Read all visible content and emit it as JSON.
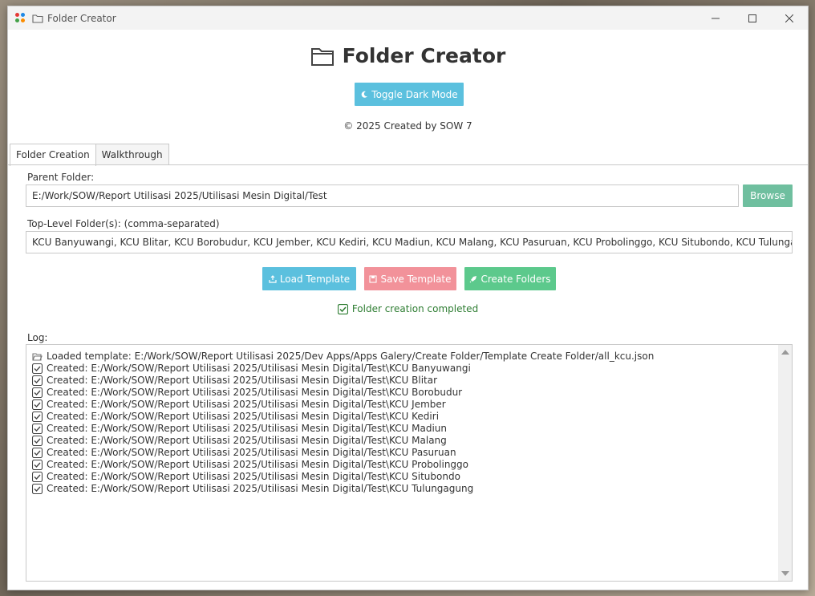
{
  "window": {
    "title": "Folder Creator",
    "controls": [
      "minimize-icon",
      "maximize-icon",
      "close-icon"
    ]
  },
  "header": {
    "title": "Folder Creator",
    "toggle_dark_label": "Toggle Dark Mode",
    "copyright": "© 2025 Created by SOW 7"
  },
  "tabs": [
    {
      "label": "Folder Creation",
      "active": true
    },
    {
      "label": "Walkthrough",
      "active": false
    }
  ],
  "form": {
    "parent_label": "Parent Folder:",
    "parent_value": "E:/Work/SOW/Report Utilisasi 2025/Utilisasi Mesin Digital/Test",
    "browse_label": "Browse",
    "top_label": "Top-Level Folder(s): (comma-separated)",
    "top_value": "KCU Banyuwangi, KCU Blitar, KCU Borobudur, KCU Jember, KCU Kediri, KCU Madiun, KCU Malang, KCU Pasuruan, KCU Probolinggo, KCU Situbondo, KCU Tulungagung"
  },
  "actions": {
    "load_label": "Load Template",
    "save_label": "Save Template",
    "create_label": "Create Folders"
  },
  "status": {
    "text": "Folder creation completed"
  },
  "log": {
    "label": "Log:",
    "lines": [
      {
        "icon": "folder-open-icon",
        "text": "Loaded template: E:/Work/SOW/Report Utilisasi 2025/Dev Apps/Apps Galery/Create Folder/Template Create Folder/all_kcu.json"
      },
      {
        "icon": "check-icon",
        "text": "Created: E:/Work/SOW/Report Utilisasi 2025/Utilisasi Mesin Digital/Test\\KCU Banyuwangi"
      },
      {
        "icon": "check-icon",
        "text": "Created: E:/Work/SOW/Report Utilisasi 2025/Utilisasi Mesin Digital/Test\\KCU Blitar"
      },
      {
        "icon": "check-icon",
        "text": "Created: E:/Work/SOW/Report Utilisasi 2025/Utilisasi Mesin Digital/Test\\KCU Borobudur"
      },
      {
        "icon": "check-icon",
        "text": "Created: E:/Work/SOW/Report Utilisasi 2025/Utilisasi Mesin Digital/Test\\KCU Jember"
      },
      {
        "icon": "check-icon",
        "text": "Created: E:/Work/SOW/Report Utilisasi 2025/Utilisasi Mesin Digital/Test\\KCU Kediri"
      },
      {
        "icon": "check-icon",
        "text": "Created: E:/Work/SOW/Report Utilisasi 2025/Utilisasi Mesin Digital/Test\\KCU Madiun"
      },
      {
        "icon": "check-icon",
        "text": "Created: E:/Work/SOW/Report Utilisasi 2025/Utilisasi Mesin Digital/Test\\KCU Malang"
      },
      {
        "icon": "check-icon",
        "text": "Created: E:/Work/SOW/Report Utilisasi 2025/Utilisasi Mesin Digital/Test\\KCU Pasuruan"
      },
      {
        "icon": "check-icon",
        "text": "Created: E:/Work/SOW/Report Utilisasi 2025/Utilisasi Mesin Digital/Test\\KCU Probolinggo"
      },
      {
        "icon": "check-icon",
        "text": "Created: E:/Work/SOW/Report Utilisasi 2025/Utilisasi Mesin Digital/Test\\KCU Situbondo"
      },
      {
        "icon": "check-icon",
        "text": "Created: E:/Work/SOW/Report Utilisasi 2025/Utilisasi Mesin Digital/Test\\KCU Tulungagung"
      }
    ]
  },
  "colors": {
    "info": "#5bc0de",
    "browse": "#6fbf9f",
    "save": "#f2929a",
    "create": "#5cc98c",
    "success_text": "#2e7d32"
  }
}
